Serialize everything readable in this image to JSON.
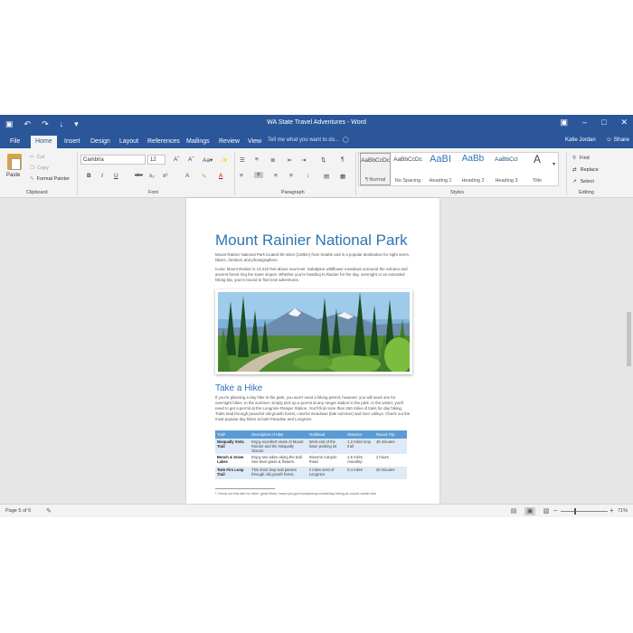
{
  "window": {
    "title": "WA State Travel Adventures - Word",
    "qat": [
      "▣",
      "↶",
      "↷",
      "↓",
      "▾"
    ],
    "controls": [
      "▣",
      "–",
      "□",
      "✕"
    ]
  },
  "tabs": [
    "File",
    "Home",
    "Insert",
    "Design",
    "Layout",
    "References",
    "Mailings",
    "Review",
    "View"
  ],
  "active_tab": "Home",
  "tell_me": {
    "placeholder": "Tell me what you want to do...",
    "icon": "lightbulb-icon"
  },
  "user": {
    "name": "Katie Jordan",
    "share_label": "Share"
  },
  "ribbon": {
    "clipboard": {
      "paste": "Paste",
      "cut": "Cut",
      "copy": "Copy",
      "format_painter": "Format Painter",
      "label": "Clipboard"
    },
    "font": {
      "name": "Cambria",
      "size": "12",
      "label": "Font",
      "row1": [
        "Aˆ",
        "Aˇ",
        "Aa▾",
        "✨"
      ],
      "row2": [
        "B",
        "I",
        "U",
        "abc",
        "x₂",
        "x²",
        "A",
        "✎",
        "A"
      ]
    },
    "paragraph": {
      "label": "Paragraph",
      "row1": [
        "☰",
        "≡",
        "≣",
        "⇤",
        "⇥",
        "⇅",
        "¶"
      ],
      "row2": [
        "≡",
        "≡",
        "≡",
        "≡",
        "↕",
        "▤",
        "▦"
      ]
    },
    "styles": {
      "label": "Styles",
      "items": [
        {
          "sample": "AaBbCcDc",
          "name": "¶ Normal"
        },
        {
          "sample": "AaBbCcDc",
          "name": "No Spacing"
        },
        {
          "sample": "AaBI",
          "name": "Heading 1"
        },
        {
          "sample": "AaBb",
          "name": "Heading 2"
        },
        {
          "sample": "AaBbCcI",
          "name": "Heading 3"
        },
        {
          "sample": "A",
          "name": "Title"
        }
      ]
    },
    "editing": {
      "label": "Editing",
      "find": "Find",
      "replace": "Replace",
      "select": "Select"
    }
  },
  "document": {
    "title": "Mount Rainier National Park",
    "para1": "Mount Rainier National Park located 80 miles (128km) from Seattle and is a popular destination for sight seers, hikers, climbers and photographers.",
    "para2": "Iconic Mount Rainier is 14,410 feet above sea level. Subalpine wildflower meadows surround the volcano and ancient forest ring the lower slopes. Whether you're heading to Rainier for the day, overnight or an extended hiking trip, you're bound to find new adventures.",
    "heading2": "Take a Hike",
    "para3": "If you're planning a day hike in the park, you won't need a hiking permit; however, you will need one for overnight hikes. In the summer, simply pick up a permit at any ranger station in the park. In the winter, you'll need to get a permit at the Longmire Ranger Station. You'll find more than 260 miles of trails for day hiking. Trails lead through peaceful old-growth forest, colorful meadows (late summer) and river valleys. Check out the most popular day hikes at both Paradise and Longmire.",
    "table": {
      "headers": [
        "Trail¹",
        "Description of Hike",
        "Trailhead",
        "Distance",
        "Round Trip"
      ],
      "rows": [
        [
          "Nisqually Vista Trail",
          "Enjoy excellent views of Mount Rainier and the Nisqually Glacier.",
          "West end of the lower parking lot",
          "1.2 miles loop trail",
          "45 minutes"
        ],
        [
          "Bench & Snow Lakes",
          "Enjoy two lakes along the trail. See bear grass & flowers.",
          "Stevens Canyon Road",
          "2.5 miles roundtrip",
          "2 hours"
        ],
        [
          "Twin Firs Loop Trail",
          "This short loop trail passes through old growth forest.",
          "2 miles west of Longmire",
          "0.4 miles",
          "20 minutes"
        ]
      ]
    },
    "footnote": "¹ Check out this site for other great hikes: www.nps.gov/mora/planyourvisit/day-hiking-at-mount-rainier.htm"
  },
  "status": {
    "page": "Page 5 of 6",
    "zoom": "71%",
    "zoom_fraction": 0.3
  },
  "colors": {
    "accent": "#2b579a",
    "heading": "#2e74b5",
    "table_header": "#5b9bd5",
    "table_band": "#deeaf6"
  }
}
